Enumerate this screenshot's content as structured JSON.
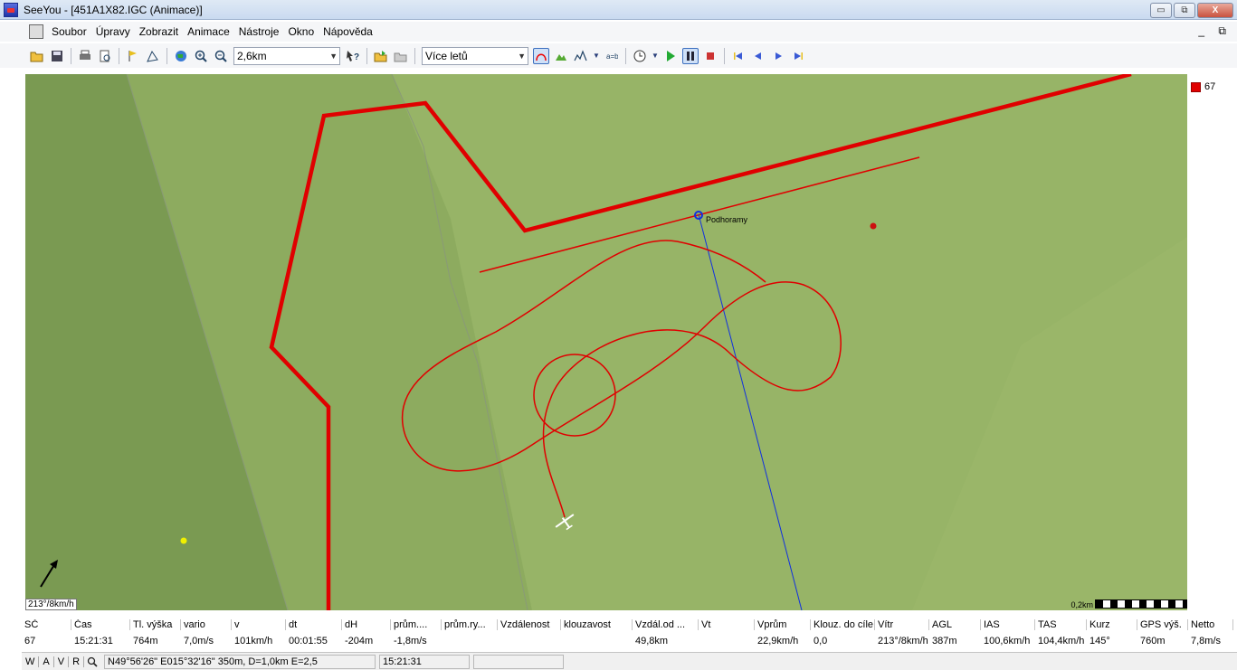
{
  "window": {
    "title": "SeeYou - [451A1X82.IGC (Animace)]",
    "minimize_glyph": "▭",
    "restore_glyph": "⧉",
    "close_glyph": "X"
  },
  "menu": {
    "items": [
      "Soubor",
      "Úpravy",
      "Zobrazit",
      "Animace",
      "Nástroje",
      "Okno",
      "Nápověda"
    ],
    "mdi_controls": "_ ⧉"
  },
  "toolbar": {
    "zoom_value": "2,6km",
    "flights_value": "Více letů"
  },
  "map": {
    "waypoint_name": "Podhoramy",
    "wind_text": "213°/8km/h",
    "scale_text": "0,2km",
    "track_color": "#e00000",
    "task_line_color": "#1030e0"
  },
  "legend": {
    "label": "67",
    "color": "#e00000"
  },
  "table": {
    "headers": [
      "SČ",
      "Čas",
      "Tl. výška",
      "vario",
      "v",
      "dt",
      "dH",
      "prům....",
      "prům.ry...",
      "Vzdálenost",
      "klouzavost",
      "Vzdál.od ...",
      "Vt",
      "Vprům",
      "Klouz. do cíle",
      "Vítr",
      "AGL",
      "IAS",
      "TAS",
      "Kurz",
      "GPS výš.",
      "Netto"
    ],
    "row": [
      "67",
      "15:21:31",
      "764m",
      "7,0m/s",
      "101km/h",
      "00:01:55",
      "-204m",
      "-1,8m/s",
      "",
      "",
      "",
      "49,8km",
      "",
      "22,9km/h",
      "0,0",
      "213°/8km/h",
      "387m",
      "100,6km/h",
      "104,4km/h",
      "145°",
      "760m",
      "7,8m/s"
    ]
  },
  "statusbar": {
    "tabs": [
      "W",
      "A",
      "V",
      "R"
    ],
    "position": "N49°56'26\" E015°32'16\" 350m, D=1,0km E=2,5",
    "time": "15:21:31"
  }
}
